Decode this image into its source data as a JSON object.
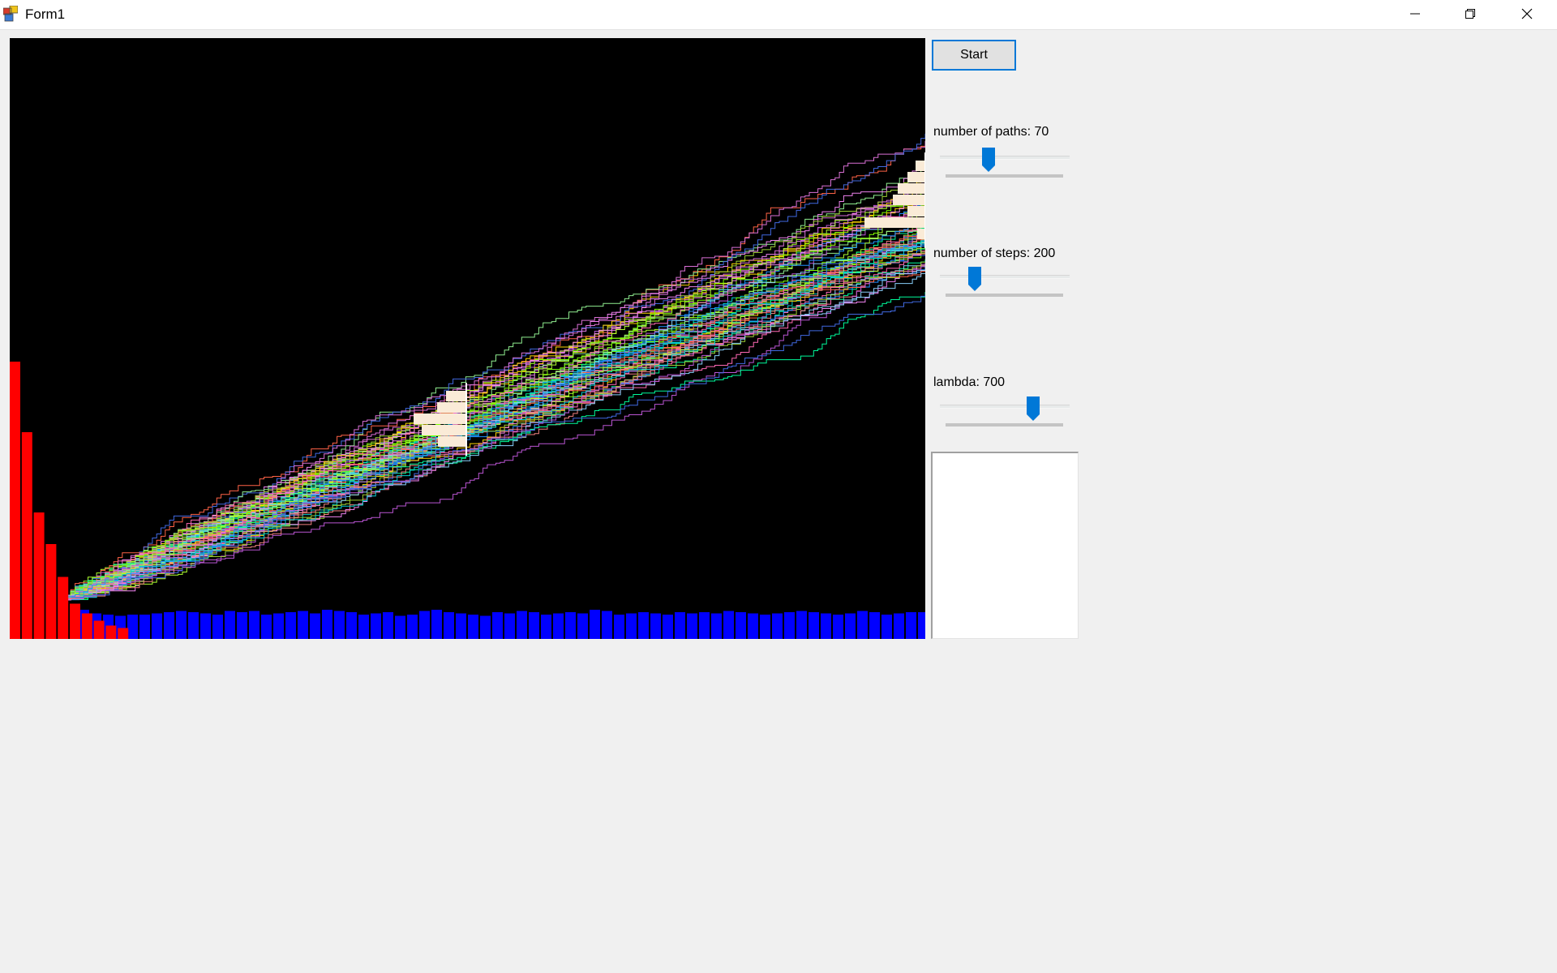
{
  "window": {
    "title": "Form1"
  },
  "titlebar": {
    "minimize_icon": "minimize-icon",
    "restore_icon": "restore-icon",
    "close_icon": "close-icon"
  },
  "controls": {
    "start_label": "Start",
    "paths_label": "number of paths: 70",
    "paths_value": 70,
    "paths_slider_fraction": 0.36,
    "steps_label": "number of steps: 200",
    "steps_value": 200,
    "steps_slider_fraction": 0.24,
    "lambda_label": "lambda: 700",
    "lambda_value": 700,
    "lambda_slider_fraction": 0.74,
    "accent_color": "#0078d7"
  },
  "output": {
    "text": ""
  },
  "plot": {
    "background": "#000000",
    "path_colors": [
      "#7cfc00",
      "#ee82ee",
      "#adff2f",
      "#00ced1",
      "#ff69b4",
      "#1e90ff",
      "#ffd700",
      "#ff6347",
      "#9acd32",
      "#ba55d3",
      "#00fa9a",
      "#da70d6",
      "#87cefa",
      "#90ee90",
      "#f08080",
      "#4169e1"
    ],
    "histogram_color": "#ff0000",
    "increments_color": "#0000ff",
    "overlay_histogram_color": "#faebd7",
    "red_bars": [
      228,
      170,
      104,
      78,
      51,
      29,
      21,
      15,
      11,
      9
    ],
    "blue_bars": [
      24,
      21,
      20,
      19,
      20,
      20,
      21,
      22,
      23,
      22,
      21,
      20,
      23,
      22,
      23,
      20,
      21,
      22,
      23,
      21,
      24,
      23,
      22,
      20,
      21,
      22,
      19,
      20,
      23,
      24,
      22,
      21,
      20,
      19,
      22,
      21,
      23,
      22,
      20,
      21,
      22,
      21,
      24,
      23,
      20,
      21,
      22,
      21,
      20,
      22,
      21,
      22,
      21,
      23,
      22,
      21,
      20,
      21,
      22,
      23,
      22,
      21,
      20,
      21,
      23,
      22,
      20,
      21,
      22,
      22,
      21,
      23,
      24
    ]
  }
}
